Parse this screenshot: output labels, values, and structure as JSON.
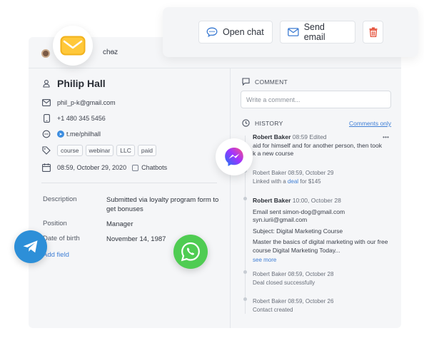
{
  "header": {
    "user_name": "chez",
    "user_chevron": "⌄"
  },
  "actions": {
    "open_chat": "Open chat",
    "send_email": "Send email",
    "delete_icon": "trash-icon"
  },
  "contact": {
    "name": "Philip Hall",
    "email": "phil_p-k@gmail.com",
    "phone": "+1 480 345 5456",
    "telegram": "t.me/philhall",
    "tags": [
      "course",
      "webinar",
      "LLC",
      "paid"
    ],
    "created": "08:59, October 29, 2020",
    "source": "Chatbots"
  },
  "fields": [
    {
      "label": "Description",
      "value": "Submitted via loyalty program form to get bonuses"
    },
    {
      "label": "Position",
      "value": "Manager"
    },
    {
      "label": "Date of birth",
      "value": "November 14, 1987"
    }
  ],
  "add_field": "Add field",
  "comment": {
    "title": "COMMENT",
    "placeholder": "Write a comment..."
  },
  "history": {
    "title": "HISTORY",
    "filter": "Comments only",
    "more": "•••",
    "entries": [
      {
        "author": "Robert Baker",
        "time": "08:59",
        "status": "Edited",
        "line1": "aid for himself and for another person,  then took",
        "line2": "k a new course"
      },
      {
        "author": "Robert Baker",
        "time": "08:59, October 29",
        "pre": "Linked with a ",
        "link": "deal",
        "post": " for $145"
      },
      {
        "author": "Robert Baker",
        "time": "10:00, October 28",
        "l1": "Email sent simon-dog@gmail.com",
        "l2": "syn.iurii@gmail.com",
        "l3": "Subject: Digital Marketing Course",
        "l4": "Master the basics of digital marketing with our free",
        "l5": "course Digital Marketing Today...",
        "more": "see more"
      },
      {
        "author": "Robert Baker",
        "time": "08:59, October 28",
        "text": "Deal closed successfully"
      },
      {
        "author": "Robert Baker",
        "time": "08:59, October 26",
        "text": "Contact created"
      }
    ]
  },
  "colors": {
    "accent": "#3f7fd6",
    "danger": "#e5533d",
    "mail": "#ffc83a",
    "whatsapp": "#4fcc52",
    "telegram": "#2d8fd8"
  }
}
